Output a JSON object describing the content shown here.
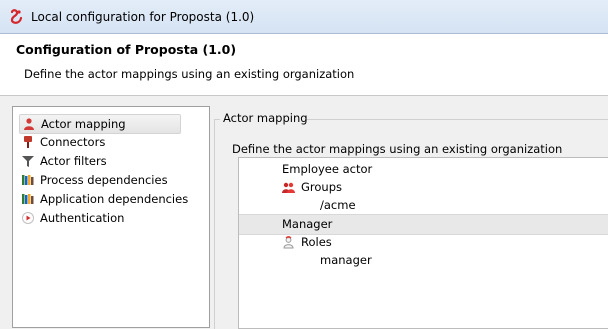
{
  "window": {
    "title": "Local configuration for Proposta (1.0)",
    "icon": "bonita-logo-icon"
  },
  "header": {
    "title": "Configuration of Proposta (1.0)",
    "subtitle": "Define the actor mappings using an existing organization"
  },
  "sidebar": {
    "items": [
      {
        "label": "Actor mapping",
        "icon": "actor-icon",
        "selected": true
      },
      {
        "label": "Connectors",
        "icon": "connector-icon"
      },
      {
        "label": "Actor filters",
        "icon": "filter-icon"
      },
      {
        "label": "Process dependencies",
        "icon": "dependencies-icon"
      },
      {
        "label": "Application dependencies",
        "icon": "dependencies-icon"
      },
      {
        "label": "Authentication",
        "icon": "authentication-icon"
      }
    ]
  },
  "main": {
    "group_title": "Actor mapping",
    "description": "Define the actor mappings using an existing organization",
    "tree": [
      {
        "label": "Employee actor"
      },
      {
        "label": "Groups",
        "icon": "groups-icon"
      },
      {
        "label": "/acme"
      },
      {
        "label": "Manager",
        "selected": true
      },
      {
        "label": "Roles",
        "icon": "roles-icon"
      },
      {
        "label": "manager"
      }
    ]
  },
  "colors": {
    "title_bar": "#dce8f5",
    "selection": "#e8e8e8",
    "actor_red": "#d23a3a"
  }
}
